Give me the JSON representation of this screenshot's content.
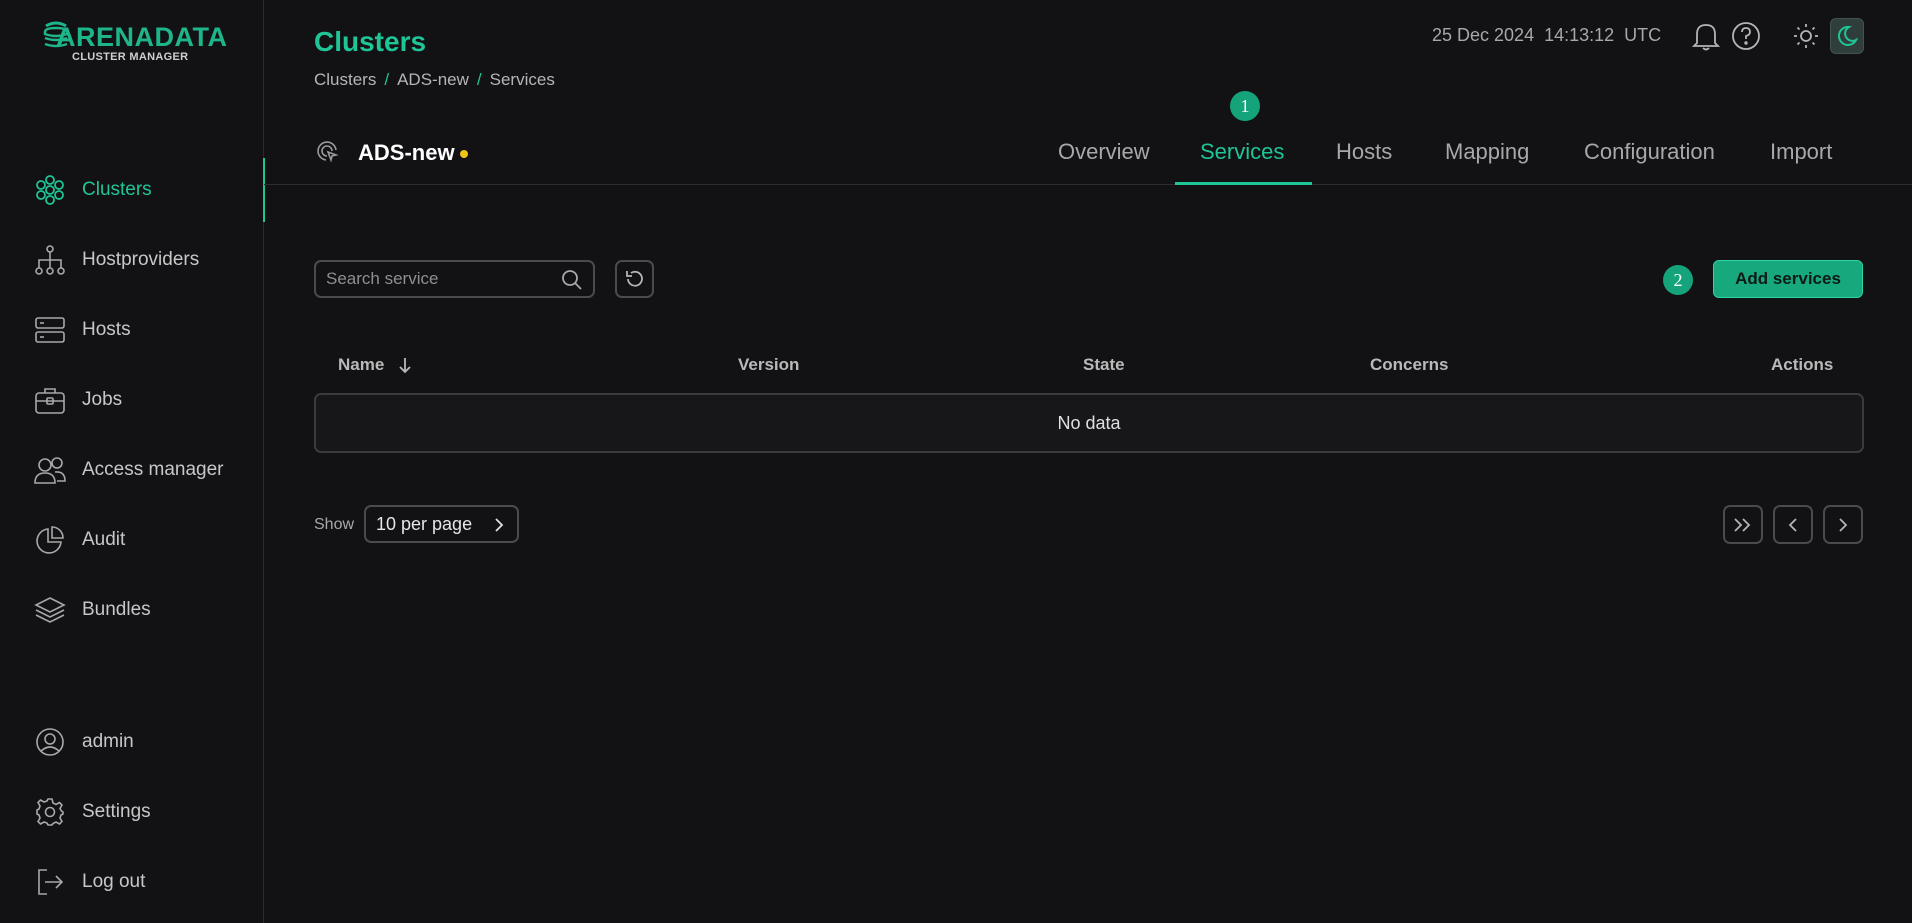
{
  "brand": {
    "name": "ARENADATA",
    "subtitle": "CLUSTER MANAGER",
    "color": "#1fc596"
  },
  "sidebar": {
    "items": [
      {
        "label": "Clusters",
        "icon": "clusters-icon",
        "active": true
      },
      {
        "label": "Hostproviders",
        "icon": "hostproviders-icon"
      },
      {
        "label": "Hosts",
        "icon": "hosts-icon"
      },
      {
        "label": "Jobs",
        "icon": "jobs-icon"
      },
      {
        "label": "Access manager",
        "icon": "access-manager-icon"
      },
      {
        "label": "Audit",
        "icon": "audit-icon"
      },
      {
        "label": "Bundles",
        "icon": "bundles-icon"
      }
    ],
    "bottom_items": [
      {
        "label": "admin",
        "icon": "user-icon"
      },
      {
        "label": "Settings",
        "icon": "settings-icon"
      },
      {
        "label": "Log out",
        "icon": "logout-icon"
      }
    ]
  },
  "header": {
    "title": "Clusters",
    "breadcrumb": [
      "Clusters",
      "ADS-new",
      "Services"
    ],
    "separator": "/",
    "date": "25 Dec 2024",
    "time": "14:13:12",
    "timezone": "UTC"
  },
  "cluster": {
    "name": "ADS-new",
    "status_color": "#f0c419",
    "tabs": [
      "Overview",
      "Services",
      "Hosts",
      "Mapping",
      "Configuration",
      "Import"
    ],
    "active_tab": "Services"
  },
  "badges": {
    "step1": "1",
    "step2": "2"
  },
  "toolbar": {
    "search_placeholder": "Search service",
    "add_label": "Add services"
  },
  "table": {
    "columns": [
      "Name",
      "Version",
      "State",
      "Concerns",
      "Actions"
    ],
    "empty_text": "No data"
  },
  "pagination": {
    "show_label": "Show",
    "per_page": "10 per page"
  }
}
